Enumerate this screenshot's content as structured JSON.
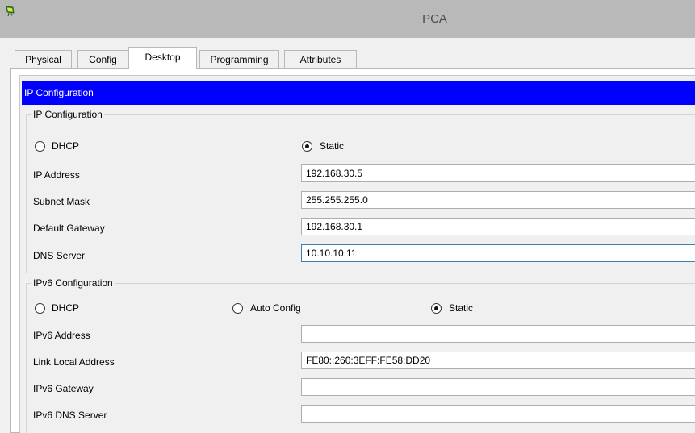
{
  "window": {
    "title": "PCA",
    "icon": "packet-tracer-pc-icon"
  },
  "tabs": [
    {
      "label": "Physical",
      "active": false
    },
    {
      "label": "Config",
      "active": false
    },
    {
      "label": "Desktop",
      "active": true
    },
    {
      "label": "Programming",
      "active": false
    },
    {
      "label": "Attributes",
      "active": false
    }
  ],
  "ip_config": {
    "header": "IP Configuration",
    "group_title": "IP Configuration",
    "mode": {
      "dhcp_label": "DHCP",
      "static_label": "Static",
      "selected": "Static"
    },
    "ip_address": {
      "label": "IP Address",
      "value": "192.168.30.5"
    },
    "subnet_mask": {
      "label": "Subnet Mask",
      "value": "255.255.255.0"
    },
    "default_gateway": {
      "label": "Default Gateway",
      "value": "192.168.30.1"
    },
    "dns_server": {
      "label": "DNS Server",
      "value": "10.10.10.11"
    }
  },
  "ipv6_config": {
    "group_title": "IPv6 Configuration",
    "mode": {
      "dhcp_label": "DHCP",
      "auto_label": "Auto Config",
      "static_label": "Static",
      "selected": "Static"
    },
    "ipv6_address": {
      "label": "IPv6 Address",
      "value": ""
    },
    "link_local": {
      "label": "Link Local Address",
      "value": "FE80::260:3EFF:FE58:DD20"
    },
    "ipv6_gateway": {
      "label": "IPv6 Gateway",
      "value": ""
    },
    "ipv6_dns": {
      "label": "IPv6 DNS Server",
      "value": ""
    }
  },
  "colors": {
    "titlebar": "#b9b9b9",
    "header_blue": "#0000ff",
    "panel": "#f0f0f0"
  }
}
